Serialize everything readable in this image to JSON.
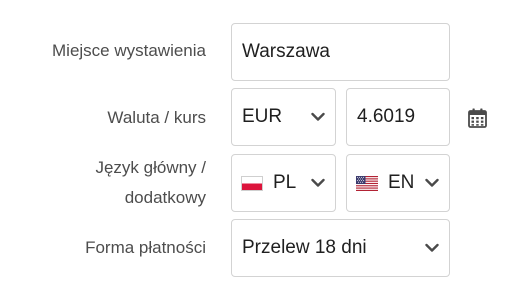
{
  "form": {
    "place": {
      "label": "Miejsce wystawienia",
      "value": "Warszawa"
    },
    "currency": {
      "label": "Waluta / kurs",
      "selected": "EUR",
      "rate": "4.6019",
      "calendar_icon": "calendar-icon"
    },
    "language": {
      "label_line1": "Język główny /",
      "label_line2": "dodatkowy",
      "primary": "PL",
      "primary_flag": "poland-flag-icon",
      "secondary": "EN",
      "secondary_flag": "usa-flag-icon"
    },
    "payment": {
      "label": "Forma płatności",
      "selected": "Przelew 18 dni"
    }
  },
  "colors": {
    "border": "#d3d3d3",
    "label_text": "#4d4d4d",
    "value_text": "#1f1f1f",
    "chevron": "#4a4a4a",
    "poland_red": "#dc143c",
    "usa_red": "#b22234",
    "usa_blue": "#3c3b6e"
  }
}
